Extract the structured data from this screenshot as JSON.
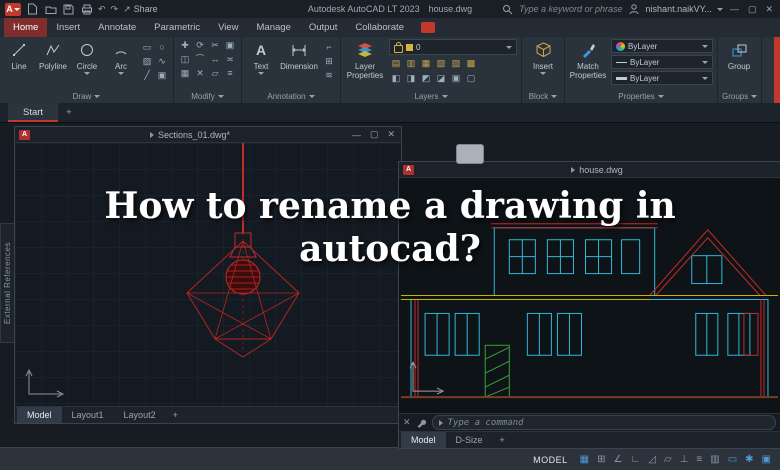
{
  "title_bar": {
    "logo_letter": "A",
    "share_glyph": "↗",
    "share_label": "Share",
    "title": "Autodesk AutoCAD LT 2023 house.dwg",
    "search_placeholder": "Type a keyword or phrase",
    "user_name": "nishant.naikVY...",
    "undo": "↶",
    "redo": "↷",
    "minimize": "—",
    "maximize": "▢",
    "close": "✕"
  },
  "ribbon_tabs": [
    {
      "label": "Home"
    },
    {
      "label": "Insert"
    },
    {
      "label": "Annotate"
    },
    {
      "label": "Parametric"
    },
    {
      "label": "View"
    },
    {
      "label": "Manage"
    },
    {
      "label": "Output"
    },
    {
      "label": "Collaborate"
    }
  ],
  "panels": {
    "draw": {
      "label": "Draw",
      "line": "Line",
      "polyline": "Polyline",
      "circle": "Circle",
      "arc": "Arc",
      "minis": [
        {
          "name": "rectangle",
          "glyph": "▭"
        },
        {
          "name": "ellipse",
          "glyph": "○"
        },
        {
          "name": "hatch",
          "glyph": "▨"
        },
        {
          "name": "spline",
          "glyph": "∿"
        },
        {
          "name": "construction-line",
          "glyph": "╱"
        },
        {
          "name": "region",
          "glyph": "▣"
        }
      ]
    },
    "modify": {
      "label": "Modify",
      "icons": [
        {
          "name": "move",
          "glyph": "✚"
        },
        {
          "name": "rotate",
          "glyph": "⟳"
        },
        {
          "name": "trim",
          "glyph": "✂"
        },
        {
          "name": "copy",
          "glyph": "▣"
        },
        {
          "name": "mirror",
          "glyph": "◫"
        },
        {
          "name": "fillet",
          "glyph": "⌒"
        },
        {
          "name": "stretch",
          "glyph": "↔"
        },
        {
          "name": "scale",
          "glyph": "≍"
        },
        {
          "name": "array",
          "glyph": "▦"
        },
        {
          "name": "erase",
          "glyph": "✕"
        },
        {
          "name": "offset",
          "glyph": "▱"
        },
        {
          "name": "explode",
          "glyph": "≡"
        }
      ]
    },
    "annotation": {
      "label": "Annotation",
      "text": "Text",
      "text_icon": "A",
      "dimension": "Dimension",
      "minis": [
        {
          "name": "leader",
          "glyph": "⌐"
        },
        {
          "name": "table",
          "glyph": "⊞"
        },
        {
          "name": "markup",
          "glyph": "≋"
        }
      ]
    },
    "layers": {
      "label": "Layers",
      "big": "Layer Properties",
      "layer_value": "0",
      "minis": [
        {
          "glyph": "▤"
        },
        {
          "glyph": "▥"
        },
        {
          "glyph": "▦"
        },
        {
          "glyph": "▧"
        },
        {
          "glyph": "▨"
        },
        {
          "glyph": "▩"
        },
        {
          "glyph": "◧"
        },
        {
          "glyph": "◨"
        },
        {
          "glyph": "◩"
        },
        {
          "glyph": "◪"
        },
        {
          "glyph": "▣"
        },
        {
          "glyph": "▢"
        }
      ]
    },
    "block": {
      "label": "Block",
      "insert": "Insert"
    },
    "properties": {
      "label": "Properties",
      "match": "Match Properties",
      "rows": [
        {
          "value": "ByLayer"
        },
        {
          "value": "ByLayer"
        },
        {
          "value": "ByLayer"
        }
      ]
    },
    "groups": {
      "label": "Groups",
      "group": "Group"
    }
  },
  "file_tabs": {
    "start": "Start",
    "new_tab": "+"
  },
  "sections_window": {
    "title": "Sections_01.dwg*",
    "tabs": [
      {
        "label": "Model"
      },
      {
        "label": "Layout1"
      },
      {
        "label": "Layout2"
      }
    ],
    "new_tab": "+"
  },
  "house_window": {
    "title": "house.dwg",
    "command_placeholder": "Type a command",
    "tabs": [
      {
        "label": "Model"
      },
      {
        "label": "D-Size"
      }
    ],
    "new_tab": "+"
  },
  "overlay": {
    "line1": "How to rename a drawing in",
    "line2": "autocad?"
  },
  "side_panel": {
    "label": "External References"
  },
  "status_bar": {
    "model_label": "MODEL",
    "icons": [
      {
        "name": "grid",
        "glyph": "▦"
      },
      {
        "name": "snap",
        "glyph": "⊞"
      },
      {
        "name": "infer-constraints",
        "glyph": "∠"
      },
      {
        "name": "ortho",
        "glyph": "∟"
      },
      {
        "name": "polar-tracking",
        "glyph": "◿"
      },
      {
        "name": "isodraft",
        "glyph": "▱"
      },
      {
        "name": "object-snap",
        "glyph": "⊥"
      },
      {
        "name": "lineweight",
        "glyph": "≡"
      },
      {
        "name": "transparency",
        "glyph": "▥"
      },
      {
        "name": "selection-cycling",
        "glyph": "▭"
      },
      {
        "name": "annotation-scale",
        "glyph": "✱"
      },
      {
        "name": "workspace-switch",
        "glyph": "▣"
      }
    ]
  },
  "colors": {
    "accent_red": "#c0392b",
    "cyan": "#2fb9d8",
    "drawing_red": "#c22b2b",
    "yellow": "#c8b400",
    "green": "#3aa23a",
    "active_blue": "#4f9bd8"
  }
}
